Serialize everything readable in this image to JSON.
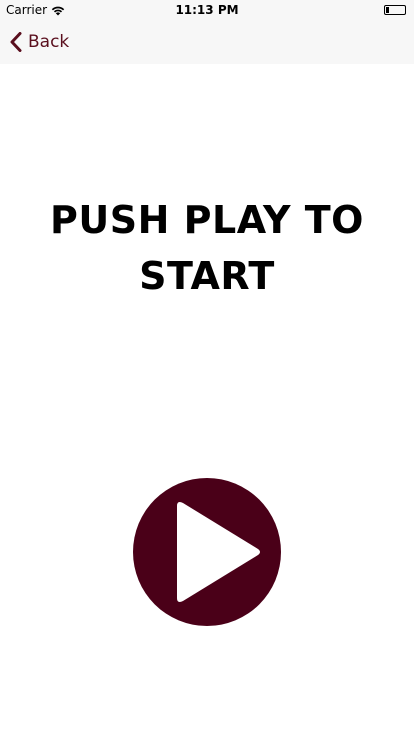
{
  "status_bar": {
    "carrier": "Carrier",
    "time": "11:13 PM",
    "wifi_icon": "wifi-icon",
    "battery_icon": "battery-icon"
  },
  "nav": {
    "back_label": "Back",
    "back_icon": "chevron-left-icon",
    "tint_color": "#5a0f1e"
  },
  "main": {
    "title": "PUSH PLAY TO START",
    "play_button_icon": "play-icon",
    "play_button_color": "#4a0018"
  }
}
